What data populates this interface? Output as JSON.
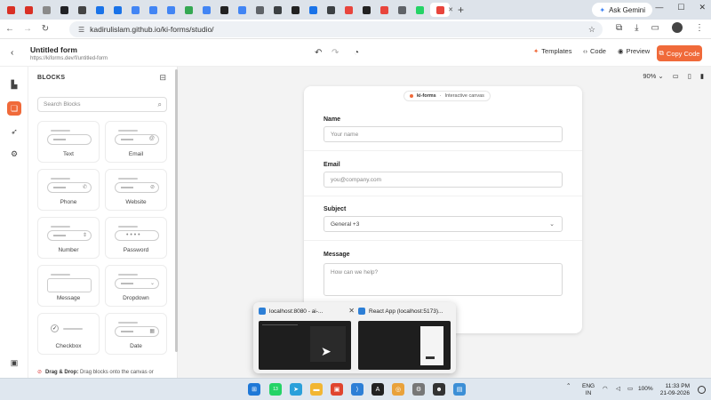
{
  "browser": {
    "tabs": [
      {
        "icon": "gmail-icon",
        "color": "#d93025"
      },
      {
        "icon": "gmail-icon",
        "color": "#d93025"
      },
      {
        "icon": "pinned-icon",
        "color": "#8a8a8a"
      },
      {
        "icon": "app-icon",
        "color": "#202124"
      },
      {
        "icon": "app-icon",
        "color": "#444444"
      },
      {
        "icon": "chrome-icon",
        "color": "#1a73e8"
      },
      {
        "icon": "chrome-icon",
        "color": "#1a73e8"
      },
      {
        "icon": "site-icon",
        "color": "#4285f4"
      },
      {
        "icon": "site-icon",
        "color": "#4285f4"
      },
      {
        "icon": "site-icon",
        "color": "#4285f4"
      },
      {
        "icon": "google-icon",
        "color": "#34a853"
      },
      {
        "icon": "site-icon",
        "color": "#4285f4"
      },
      {
        "icon": "notion-icon",
        "color": "#222222"
      },
      {
        "icon": "site-icon",
        "color": "#4285f4"
      },
      {
        "icon": "site-icon",
        "color": "#5f6368"
      },
      {
        "icon": "site-icon",
        "color": "#3c4043"
      },
      {
        "icon": "site-icon",
        "color": "#222222"
      },
      {
        "icon": "arrow-icon",
        "color": "#1a73e8"
      },
      {
        "icon": "site-icon",
        "color": "#3c4043"
      },
      {
        "icon": "site-icon",
        "color": "#e8453c"
      },
      {
        "icon": "github-icon",
        "color": "#222222"
      },
      {
        "icon": "site-icon",
        "color": "#e8453c"
      },
      {
        "icon": "site-icon",
        "color": "#5f6368"
      },
      {
        "icon": "whatsapp-icon",
        "color": "#25d366"
      },
      {
        "icon": "site-icon",
        "color": "#e8453c"
      }
    ],
    "new_tab": "+",
    "gemini_label": "Ask Gemini",
    "url": "kadirulislam.github.io/ki-forms/studio/"
  },
  "app": {
    "form_title": "Untitled form",
    "form_url": "https://kiforms.dev/f/untitled-form",
    "templates_label": "Templates",
    "code_label": "Code",
    "preview_label": "Preview",
    "copy_code_label": "Copy Code",
    "accent": "#f06a3a"
  },
  "panel": {
    "title": "BLOCKS",
    "search_placeholder": "Search Blocks",
    "blocks": [
      {
        "label": "Text",
        "kind": "field",
        "icon": ""
      },
      {
        "label": "Email",
        "kind": "field",
        "icon": "@"
      },
      {
        "label": "Phone",
        "kind": "field",
        "icon": "✆"
      },
      {
        "label": "Website",
        "kind": "field",
        "icon": "⊘"
      },
      {
        "label": "Number",
        "kind": "field",
        "icon": "⇕"
      },
      {
        "label": "Password",
        "kind": "password",
        "icon": "• • • •"
      },
      {
        "label": "Message",
        "kind": "area",
        "icon": ""
      },
      {
        "label": "Dropdown",
        "kind": "field",
        "icon": "⌄"
      },
      {
        "label": "Checkbox",
        "kind": "check",
        "icon": "✓"
      },
      {
        "label": "Date",
        "kind": "field",
        "icon": "▦"
      }
    ],
    "dnd_title": "Drag & Drop:",
    "dnd_text": "Drag blocks onto the canvas or"
  },
  "canvas": {
    "zoom": "90%",
    "badge_brand": "ki-forms",
    "badge_text": "Interactive canvas",
    "fields": [
      {
        "label": "Name",
        "placeholder": "Your name",
        "type": "input"
      },
      {
        "label": "Email",
        "placeholder": "you@company.com",
        "type": "input"
      },
      {
        "label": "Subject",
        "placeholder": "General +3",
        "type": "select"
      },
      {
        "label": "Message",
        "placeholder": "How can we help?",
        "type": "textarea"
      }
    ]
  },
  "taskbar_preview": {
    "windows": [
      {
        "title": "localhost:8080 - ai-..."
      },
      {
        "title": "React App (localhost:5173)..."
      }
    ]
  },
  "taskbar": {
    "lang_line1": "ENG",
    "lang_line2": "IN",
    "battery": "100%",
    "time": "11:33 PM",
    "date": "21-09-2026",
    "whatsapp_badge": "13"
  }
}
